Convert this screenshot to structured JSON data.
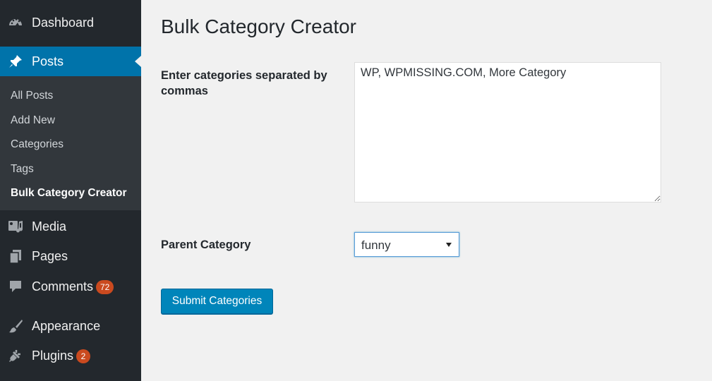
{
  "sidebar": {
    "dashboard": {
      "label": "Dashboard",
      "icon": "dashboard-icon"
    },
    "posts": {
      "label": "Posts",
      "icon": "pin-icon"
    },
    "posts_submenu": [
      {
        "label": "All Posts"
      },
      {
        "label": "Add New"
      },
      {
        "label": "Categories"
      },
      {
        "label": "Tags"
      },
      {
        "label": "Bulk Category Creator",
        "current": true
      }
    ],
    "media": {
      "label": "Media",
      "icon": "media-icon"
    },
    "pages": {
      "label": "Pages",
      "icon": "pages-icon"
    },
    "comments": {
      "label": "Comments",
      "icon": "comment-icon",
      "badge": "72"
    },
    "appearance": {
      "label": "Appearance",
      "icon": "brush-icon"
    },
    "plugins": {
      "label": "Plugins",
      "icon": "plugin-icon",
      "badge": "2"
    }
  },
  "main": {
    "title": "Bulk Category Creator",
    "categories_label": "Enter categories separated by commas",
    "categories_value": "WP, WPMISSING.COM, More Category",
    "parent_label": "Parent Category",
    "parent_value": "funny",
    "submit_label": "Submit Categories"
  },
  "colors": {
    "sidebar_bg": "#23282d",
    "submenu_bg": "#32373c",
    "accent": "#0073aa",
    "button": "#0085ba",
    "badge": "#ca4a1f",
    "page_bg": "#f1f1f1"
  }
}
